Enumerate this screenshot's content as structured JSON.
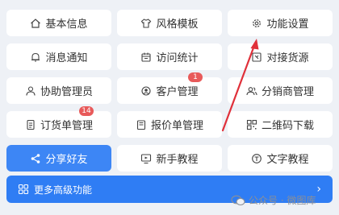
{
  "tiles": [
    {
      "label": "基本信息",
      "icon": "home-icon"
    },
    {
      "label": "风格模板",
      "icon": "shirt-icon"
    },
    {
      "label": "功能设置",
      "icon": "gear-icon"
    },
    {
      "label": "消息通知",
      "icon": "bell-icon"
    },
    {
      "label": "访问统计",
      "icon": "calendar-icon"
    },
    {
      "label": "对接货源",
      "icon": "box-icon"
    },
    {
      "label": "协助管理员",
      "icon": "user-icon"
    },
    {
      "label": "客户管理",
      "icon": "customer-icon",
      "badge": "1"
    },
    {
      "label": "分销商管理",
      "icon": "users-icon"
    },
    {
      "label": "订货单管理",
      "icon": "document-icon",
      "badge": "14"
    },
    {
      "label": "报价单管理",
      "icon": "quote-icon"
    },
    {
      "label": "二维码下载",
      "icon": "qr-icon"
    },
    {
      "label": "分享好友",
      "icon": "share-icon"
    },
    {
      "label": "新手教程",
      "icon": "monitor-icon"
    },
    {
      "label": "文字教程",
      "icon": "text-icon"
    }
  ],
  "bottom": {
    "label": "更多高级功能",
    "icon": "grid-icon",
    "arrow": "›"
  },
  "watermark": {
    "text": "公众号 · 微图库",
    "icon": "wechat-icon"
  },
  "colors": {
    "primary": "#3d86f5",
    "badge": "#e85a5a",
    "annotation": "#e0303a"
  }
}
